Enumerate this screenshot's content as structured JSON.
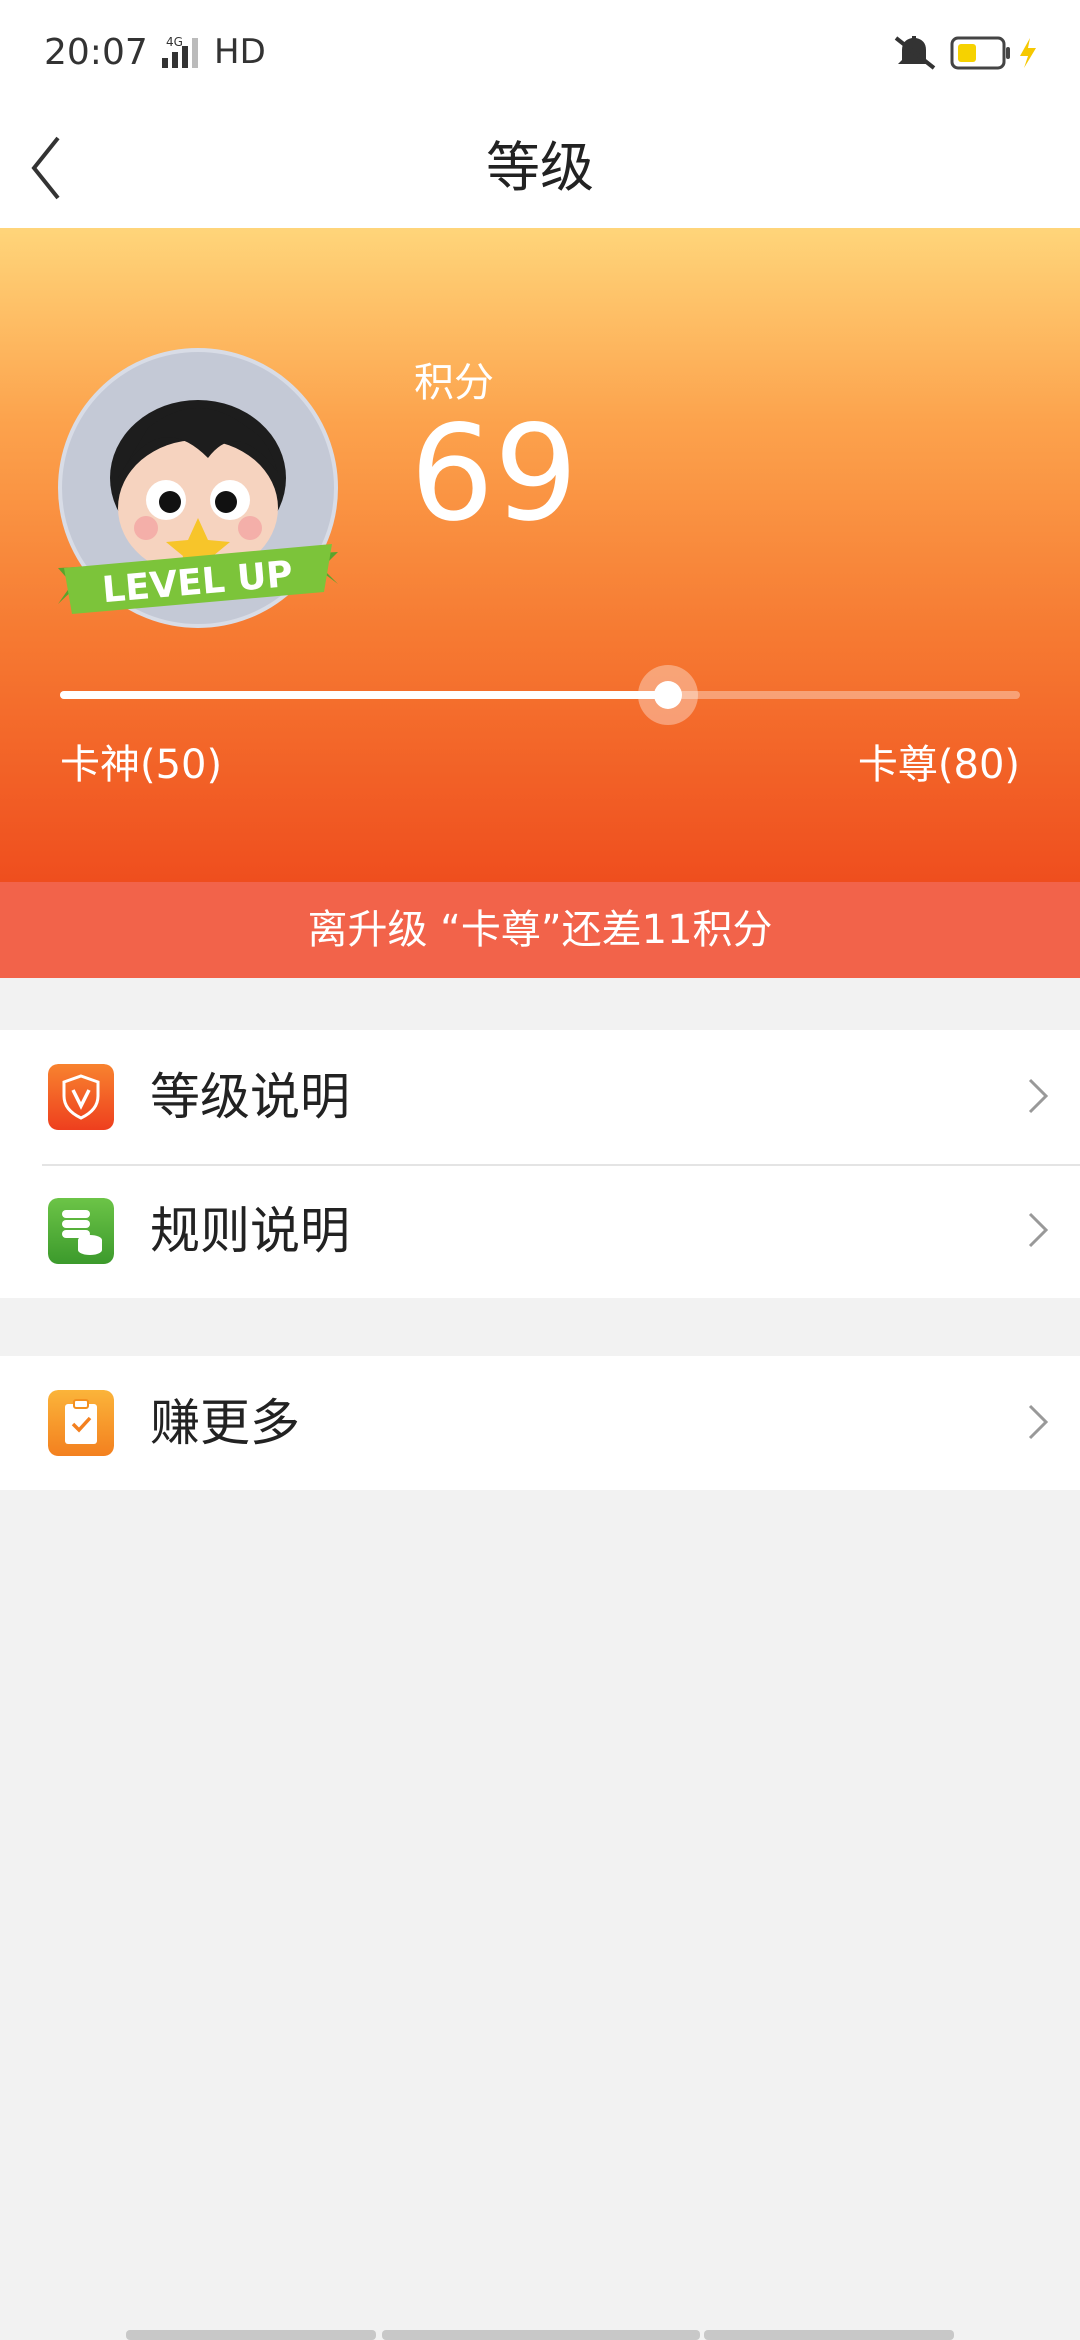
{
  "status_bar": {
    "time": "20:07",
    "network": "4G",
    "hd": "HD",
    "icons": [
      "signal-icon",
      "mute-icon",
      "battery-icon",
      "charging-bolt-icon"
    ]
  },
  "nav": {
    "title": "等级",
    "back_icon": "chevron-left-icon"
  },
  "hero": {
    "points_label": "积分",
    "points_value": "69",
    "avatar_badge": "LEVEL UP",
    "progress_fraction": 0.6333,
    "level_current": "卡神(50)",
    "level_next": "卡尊(80)",
    "colors": {
      "top": "#ffd57a",
      "bottom": "#ef4e1e"
    }
  },
  "banner": {
    "text": "离升级 “卡尊”还差11积分",
    "color": "#f2634a"
  },
  "menu": {
    "groups": [
      [
        {
          "label": "等级说明",
          "icon": "shield-v-icon",
          "icon_color": "#f0552a"
        },
        {
          "label": "规则说明",
          "icon": "coins-stack-icon",
          "icon_color": "#4caf3a"
        }
      ],
      [
        {
          "label": "赚更多",
          "icon": "clipboard-check-icon",
          "icon_color": "#f59a2a"
        }
      ]
    ]
  }
}
